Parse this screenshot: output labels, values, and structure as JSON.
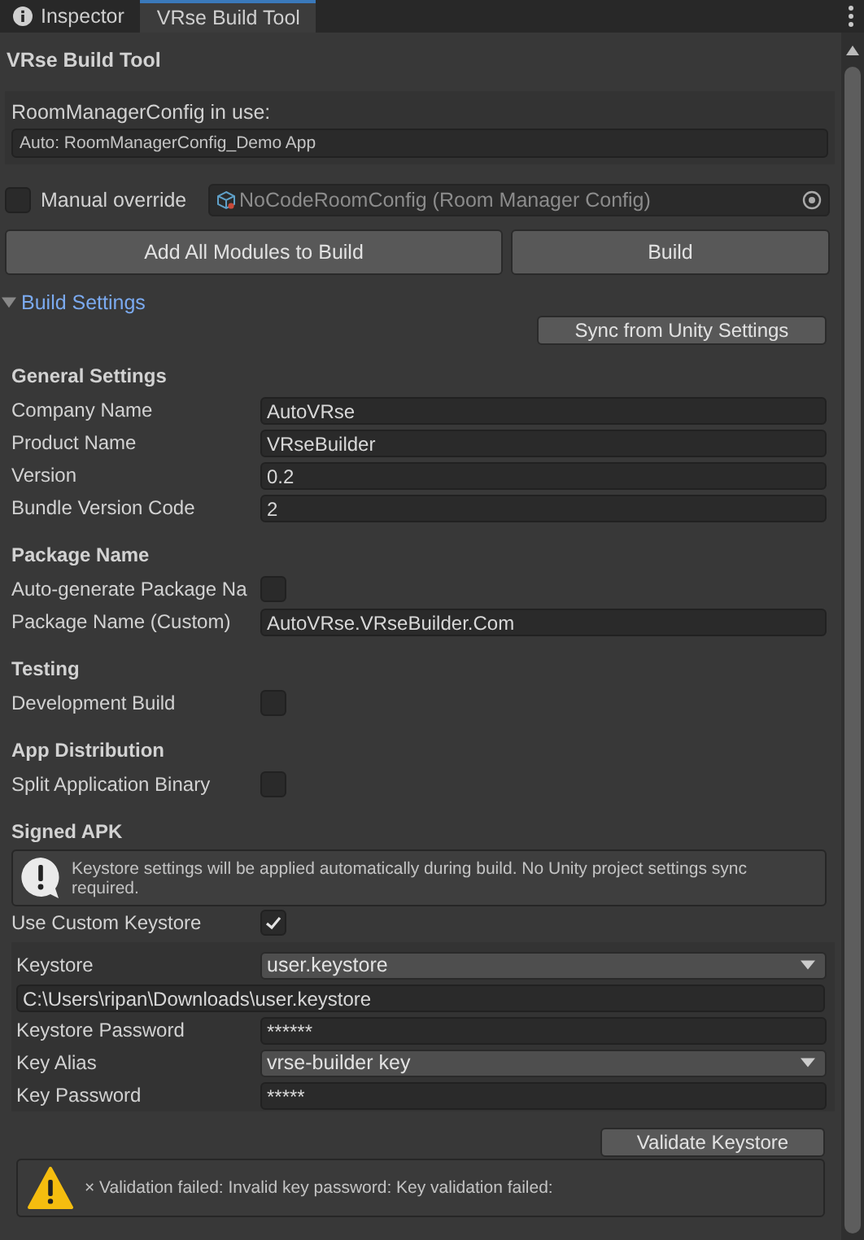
{
  "tabs": [
    {
      "label": "Inspector",
      "selected": false
    },
    {
      "label": "VRse Build Tool",
      "selected": true
    }
  ],
  "title": "VRse Build Tool",
  "config_in_use": {
    "label": "RoomManagerConfig in use:",
    "value": "Auto: RoomManagerConfig_Demo App"
  },
  "manual_override": {
    "label": "Manual override",
    "checked": false,
    "value": "NoCodeRoomConfig (Room Manager Config)",
    "disabled": true
  },
  "buttons": [
    "Add All Modules to Build",
    "Build"
  ],
  "build_settings": {
    "label": "Build Settings",
    "expanded": true,
    "sync_button": "Sync from Unity Settings",
    "groups": [
      {
        "heading": "General Settings",
        "rows": [
          {
            "kind": "text",
            "label": "Company Name",
            "value": "AutoVRse"
          },
          {
            "kind": "text",
            "label": "Product Name",
            "value": "VRseBuilder"
          },
          {
            "kind": "text",
            "label": "Version",
            "value": "0.2"
          },
          {
            "kind": "text",
            "label": "Bundle Version Code",
            "value": "2"
          }
        ]
      },
      {
        "heading": "Package Name",
        "rows": [
          {
            "kind": "checkbox",
            "label": "Auto-generate Package Na",
            "checked": false
          },
          {
            "kind": "text",
            "label": "Package Name (Custom)",
            "value": "AutoVRse.VRseBuilder.Com"
          }
        ]
      },
      {
        "heading": "Testing",
        "rows": [
          {
            "kind": "checkbox",
            "label": "Development Build",
            "checked": false
          }
        ]
      },
      {
        "heading": "App Distribution",
        "rows": [
          {
            "kind": "checkbox",
            "label": "Split Application Binary",
            "checked": false
          }
        ]
      }
    ]
  },
  "signed_apk": {
    "heading": "Signed APK",
    "info": "Keystore settings will be applied automatically during build. No Unity project settings sync required.",
    "use_custom_keystore": {
      "label": "Use Custom Keystore",
      "checked": true
    },
    "rows": [
      {
        "kind": "dropdown",
        "label": "Keystore",
        "value": "user.keystore"
      },
      {
        "kind": "path",
        "value": "C:\\Users\\ripan\\Downloads\\user.keystore"
      },
      {
        "kind": "text",
        "label": "Keystore Password",
        "value": "******"
      },
      {
        "kind": "dropdown",
        "label": "Key Alias",
        "value": "vrse-builder key"
      },
      {
        "kind": "text",
        "label": "Key Password",
        "value": "*****"
      }
    ],
    "validate_button": "Validate Keystore",
    "warning": "× Validation failed: Invalid key password: Key validation failed:"
  }
}
